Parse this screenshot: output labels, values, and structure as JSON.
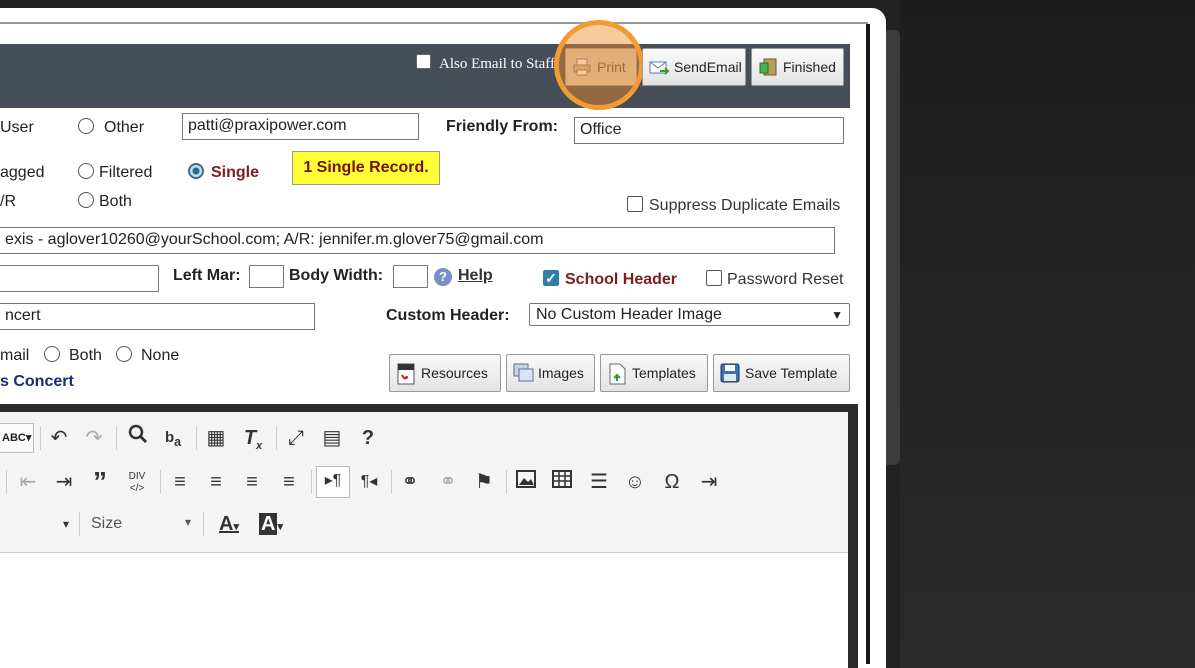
{
  "header": {
    "also_email_staff": "Also Email to Staff",
    "print": "Print",
    "send_email": "SendEmail",
    "finished": "Finished"
  },
  "from_row": {
    "user_label": "User",
    "other_label": "Other",
    "email_value": "patti@praxipower.com",
    "friendly_from_label": "Friendly From:",
    "friendly_from_value": "Office"
  },
  "record_row": {
    "tagged_label": "agged",
    "filtered_label": "Filtered",
    "single_label": "Single",
    "badge": "1 Single Record.",
    "ar_label": "/R",
    "both_label": "Both",
    "suppress_label": "Suppress Duplicate Emails"
  },
  "recipients_value": "exis - aglover10260@yourSchool.com; A/R: jennifer.m.glover75@gmail.com",
  "layout_row": {
    "left_mar_label": "Left Mar:",
    "body_width_label": "Body Width:",
    "help_label": "Help",
    "school_header_label": "School Header",
    "password_reset_label": "Password Reset"
  },
  "subject_value": "ncert",
  "custom_header": {
    "label": "Custom Header:",
    "selected": "No Custom Header Image"
  },
  "format_row": {
    "email_label": "mail",
    "both_label": "Both",
    "none_label": "None",
    "template_name": "s Concert"
  },
  "actions": {
    "resources": "Resources",
    "images": "Images",
    "templates": "Templates",
    "save_template": "Save Template"
  },
  "editor": {
    "size_label": "Size",
    "spell_label": "ABC",
    "showblocks_label": "DIV"
  },
  "colors": {
    "header_bar": "#464e58",
    "badge_bg": "#ffff33",
    "badge_text": "#7a0d0d",
    "highlight": "#f39a33",
    "single_text": "#7a2020"
  }
}
